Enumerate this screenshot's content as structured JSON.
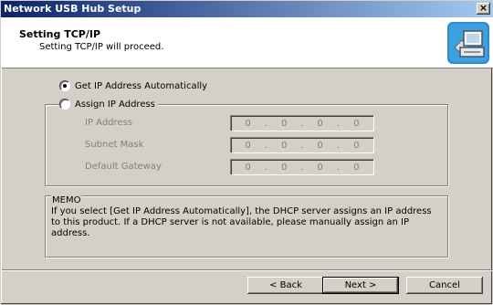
{
  "window": {
    "title": "Network USB Hub Setup",
    "close_glyph": "×"
  },
  "header": {
    "title": "Setting TCP/IP",
    "subtitle": "Setting TCP/IP will proceed."
  },
  "options": {
    "auto": {
      "label": "Get IP Address Automatically",
      "selected": true
    },
    "manual": {
      "label": "Assign IP Address",
      "selected": false
    }
  },
  "fields": [
    {
      "label": "IP Address",
      "octets": [
        "0",
        "0",
        "0",
        "0"
      ]
    },
    {
      "label": "Subnet Mask",
      "octets": [
        "0",
        "0",
        "0",
        "0"
      ]
    },
    {
      "label": "Default Gateway",
      "octets": [
        "0",
        "0",
        "0",
        "0"
      ]
    }
  ],
  "ip_separator": ".",
  "memo": {
    "title": "MEMO",
    "text": "If you select [Get IP Address Automatically], the DHCP server assigns an IP address to this product. If a DHCP server is not available, please manually assign an IP address."
  },
  "buttons": {
    "back": "< Back",
    "next": "Next >",
    "cancel": "Cancel"
  },
  "colors": {
    "title_start": "#0a246a",
    "title_end": "#a6caf0",
    "face": "#d4d0c8",
    "disabled_text": "#808080"
  },
  "icons": {
    "header": "computer-setup-icon"
  }
}
